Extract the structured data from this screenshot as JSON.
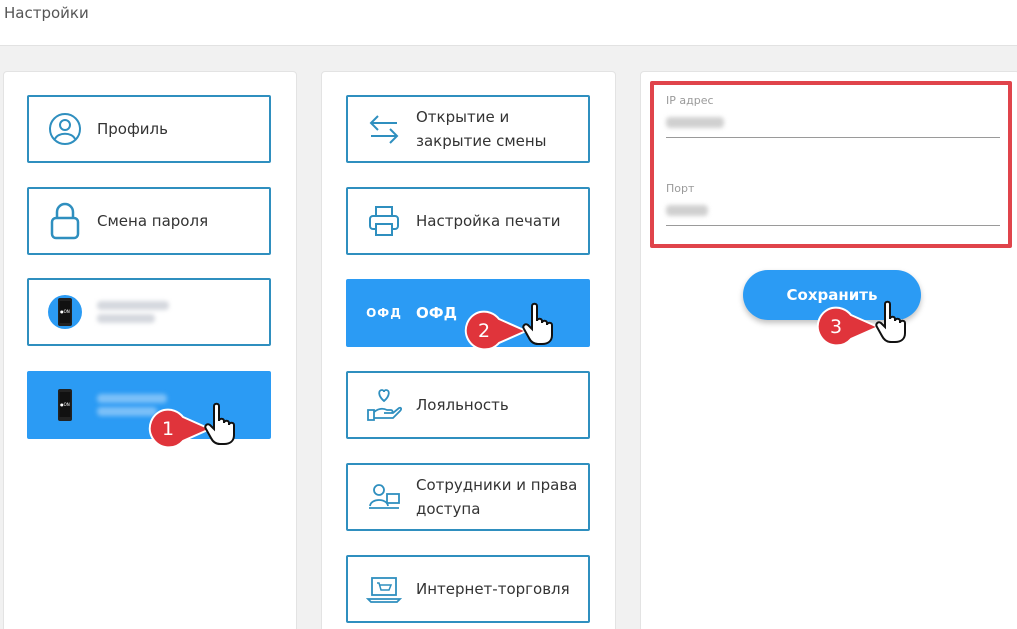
{
  "header": {
    "title": "Настройки"
  },
  "col1": {
    "items": [
      {
        "label": "Профиль",
        "icon": "profile-icon"
      },
      {
        "label": "Смена пароля",
        "icon": "lock-icon"
      },
      {
        "label": "",
        "icon": "phone-icon"
      },
      {
        "label": "",
        "icon": "phone-icon",
        "active": true
      }
    ]
  },
  "col2": {
    "items": [
      {
        "label": "Открытие и закрытие смены",
        "icon": "arrows-swap-icon"
      },
      {
        "label": "Настройка печати",
        "icon": "printer-icon"
      },
      {
        "label": "ОФД",
        "icon_text": "ОФД",
        "active": true
      },
      {
        "label": "Лояльность",
        "icon": "loyalty-hand-heart-icon"
      },
      {
        "label": "Сотрудники и права доступа",
        "icon": "employees-icon"
      },
      {
        "label": "Интернет-торговля",
        "icon": "laptop-cart-icon"
      }
    ]
  },
  "form": {
    "ip_label": "IP адрес",
    "port_label": "Порт",
    "save_label": "Сохранить"
  },
  "callouts": [
    "1",
    "2",
    "3"
  ],
  "colors": {
    "accent": "#2b9bf4",
    "tile_border": "#2f8fbf",
    "callout_red": "#e0343b",
    "highlight_box": "#e0444b"
  }
}
